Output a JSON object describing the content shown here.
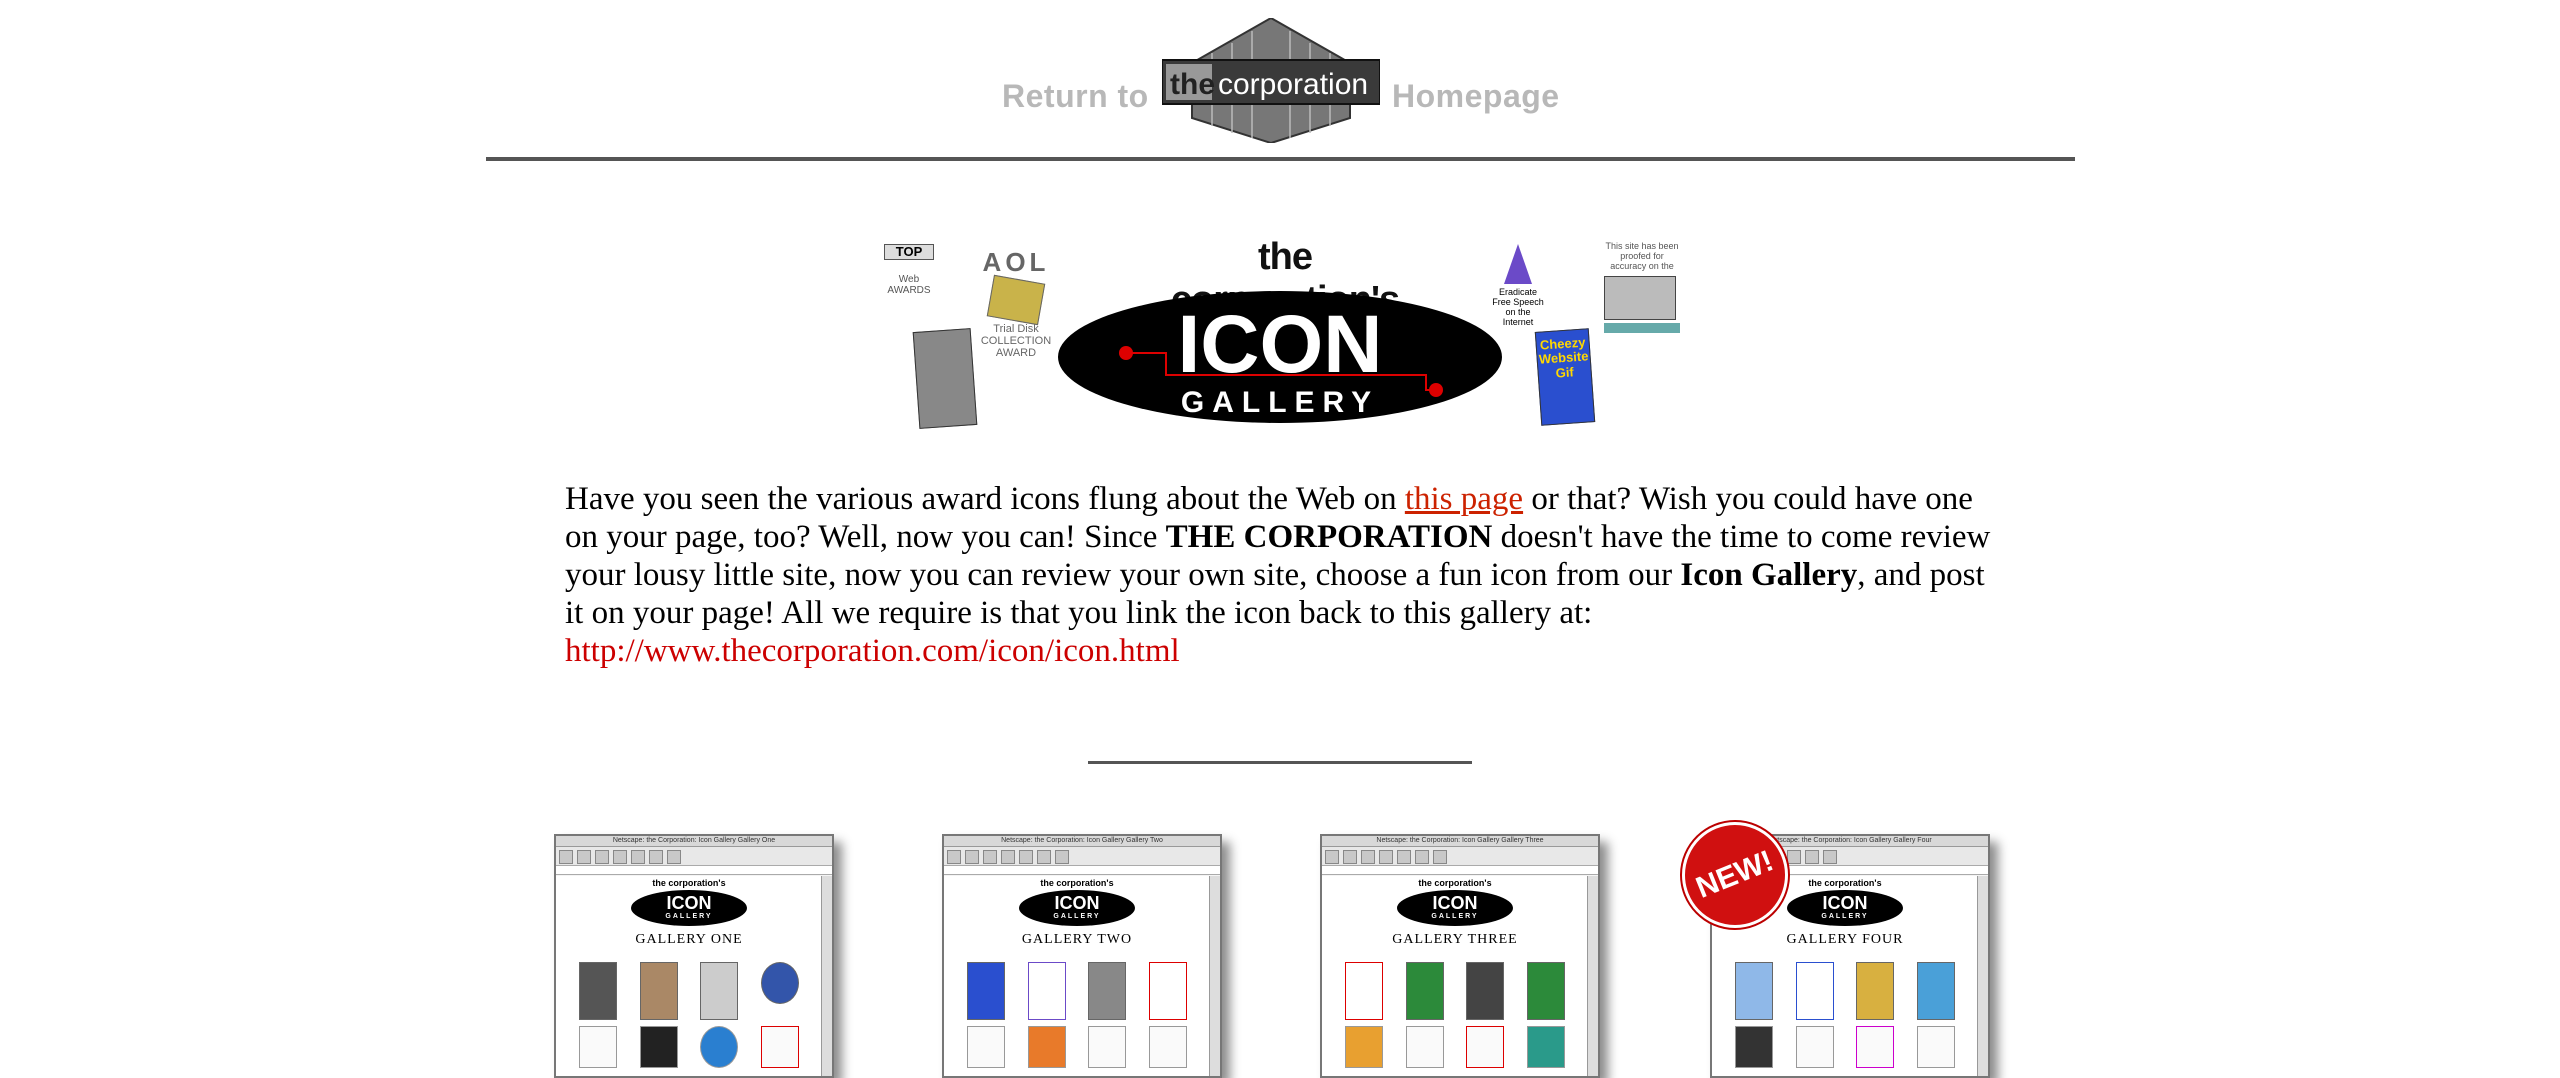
{
  "nav": {
    "return_label": "Return to",
    "logo_word1": "the",
    "logo_word2": "corporation",
    "homepage_label": "Homepage"
  },
  "banner": {
    "title": "the corporation's",
    "icon_word": "ICON",
    "gallery_word": "GALLERY",
    "mini_icons": {
      "top_web": "TOP",
      "web_awards": "Web AWARDS",
      "aol_award": "AOL",
      "trial_disk": "Trial Disk COLLECTION AWARD",
      "eradicate": "Eradicate Free Speech on the Internet",
      "cheezy": "Cheezy Website Gif",
      "proofed": "This site has been proofed for accuracy on the"
    }
  },
  "intro": {
    "part1": "Have you seen the various award icons flung about the Web on ",
    "link_text": "this page",
    "part2": " or that? Wish you could have one on your page, too? Well, now you can! Since ",
    "corp_bold": "THE CORPORATION",
    "part3": " doesn't have the time to come review your lousy little site, now you can review your own site, choose a fun icon from our ",
    "gallery_bold": "Icon Gallery",
    "part4": ", and post it on your page! All we require is that you link the icon back to this gallery at: ",
    "url": "http://www.thecorporation.com/icon/icon.html"
  },
  "galleries": [
    {
      "window_title": "Netscape: the Corporation: Icon Gallery Gallery One",
      "header": "the corporation's",
      "icon_word": "ICON",
      "gallery_word": "GALLERY",
      "label": "GALLERY ONE"
    },
    {
      "window_title": "Netscape: the Corporation: Icon Gallery Gallery Two",
      "header": "the corporation's",
      "icon_word": "ICON",
      "gallery_word": "GALLERY",
      "label": "GALLERY TWO"
    },
    {
      "window_title": "Netscape: the Corporation: Icon Gallery Gallery Three",
      "header": "the corporation's",
      "icon_word": "ICON",
      "gallery_word": "GALLERY",
      "label": "GALLERY THREE"
    },
    {
      "window_title": "Netscape: the Corporation: Icon Gallery Gallery Four",
      "header": "the corporation's",
      "icon_word": "ICON",
      "gallery_word": "GALLERY",
      "label": "GALLERY FOUR"
    }
  ],
  "new_badge": "NEW!",
  "colors": {
    "link": "#cc2200",
    "url": "#cc0000",
    "rule": "#555555",
    "nav_text": "#b8b8b8"
  }
}
